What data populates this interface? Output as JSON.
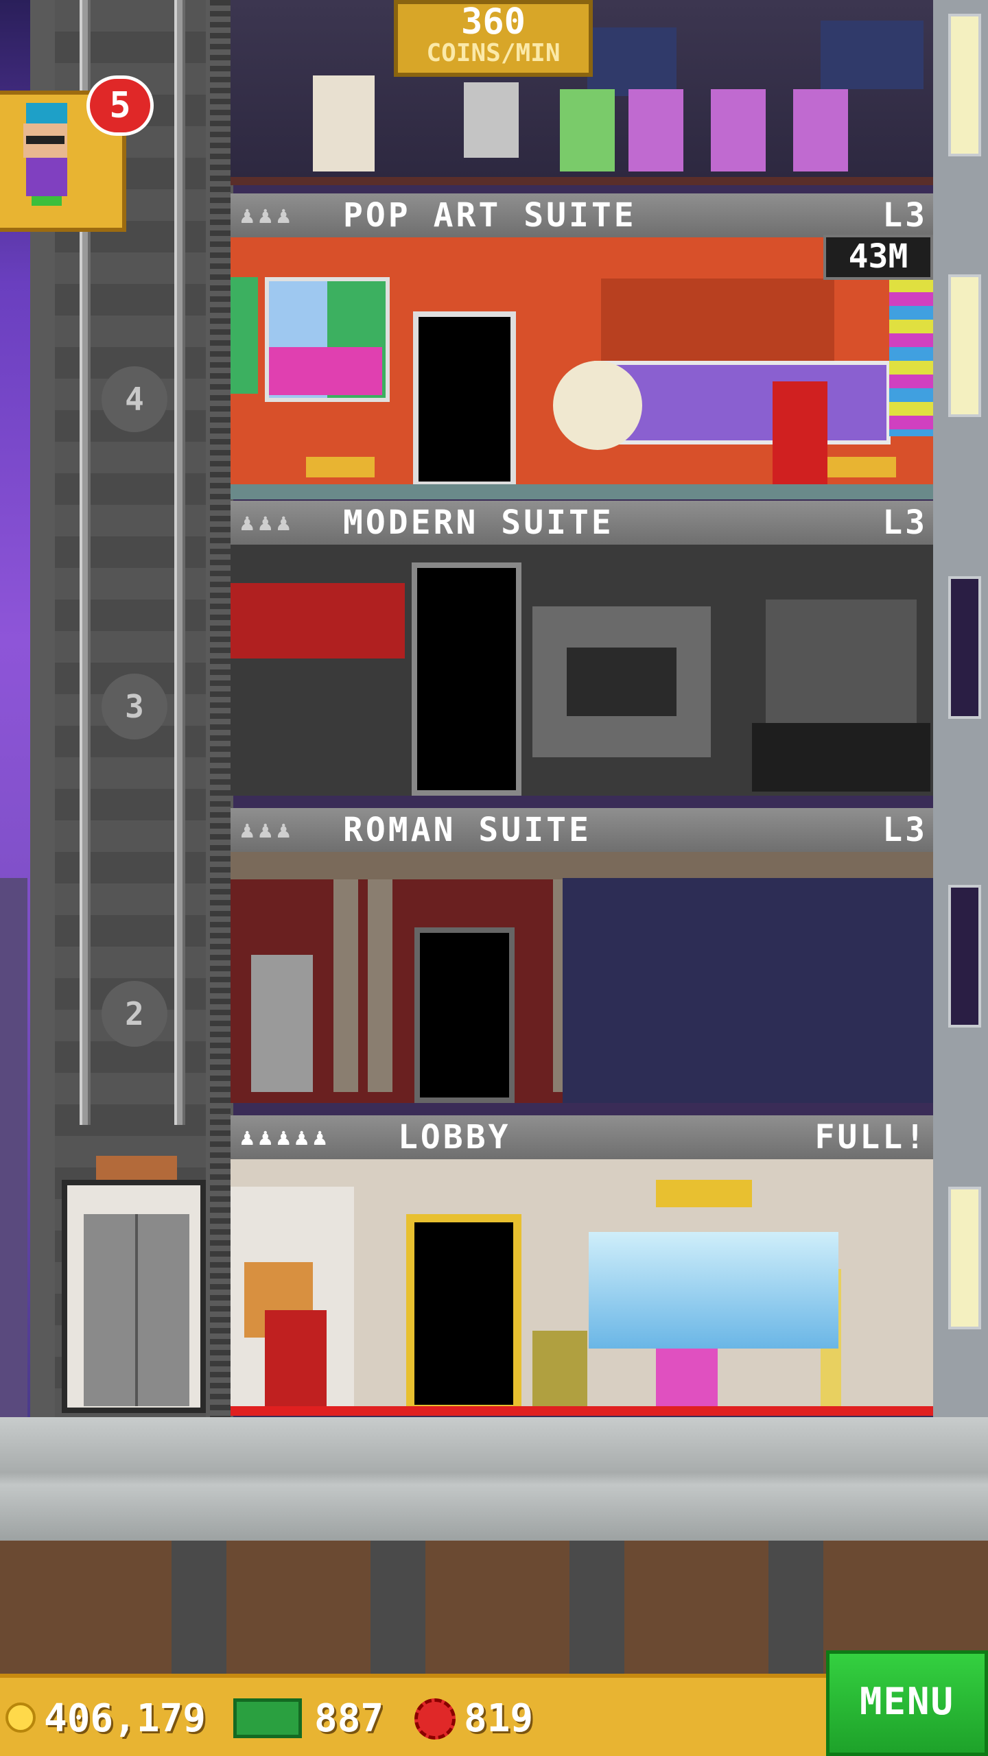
{
  "top_floor": {
    "coins_rate_value": "360",
    "coins_rate_unit": "COINS/MIN"
  },
  "notification": {
    "badge_count": "5",
    "icon": "bitbook-person-icon"
  },
  "floors": [
    {
      "number": "4",
      "name": "POP ART SUITE",
      "level": "L3",
      "people_icons": "♟♟♟",
      "earning": "43M"
    },
    {
      "number": "3",
      "name": "MODERN SUITE",
      "level": "L3",
      "people_icons": "♟♟♟"
    },
    {
      "number": "2",
      "name": "ROMAN SUITE",
      "level": "L3",
      "people_icons": "♟♟♟"
    },
    {
      "number": "",
      "name": "LOBBY",
      "level": "FULL!",
      "people_icons": "♟♟♟♟♟"
    }
  ],
  "status_bar": {
    "coins": "406,179",
    "bux": "887",
    "bitizens": "819",
    "menu_label": "MENU"
  },
  "colors": {
    "status_bar": "#e8b432",
    "menu": "#2cc038",
    "badge": "#e02828"
  }
}
